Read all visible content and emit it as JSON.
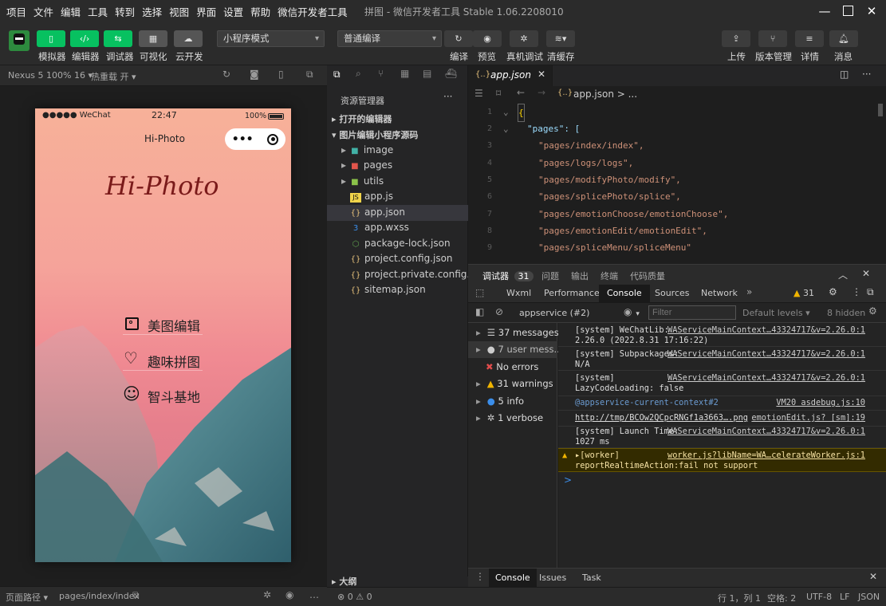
{
  "window": {
    "title": "拼图 - 微信开发者工具 Stable 1.06.2208010",
    "menus": [
      "项目",
      "文件",
      "编辑",
      "工具",
      "转到",
      "选择",
      "视图",
      "界面",
      "设置",
      "帮助",
      "微信开发者工具"
    ]
  },
  "toolbar": {
    "left_buttons": [
      "模拟器",
      "编辑器",
      "调试器",
      "可视化",
      "云开发"
    ],
    "mode_select": "小程序模式",
    "compile_select": "普通编译",
    "mid_buttons": [
      "编译",
      "预览",
      "真机调试",
      "清缓存"
    ],
    "right_buttons": [
      "上传",
      "版本管理",
      "详情",
      "消息"
    ]
  },
  "simulator": {
    "device": "Nexus 5 100% 16",
    "hot_reload": "热重载 开",
    "phone": {
      "carrier": "●●●●● WeChat",
      "time": "22:47",
      "battery": "100%",
      "nav_title": "Hi-Photo",
      "logo_text": "Hi-Photo",
      "menu_items": [
        {
          "label": "美图编辑",
          "icon": "image-icon"
        },
        {
          "label": "趣味拼图",
          "icon": "heart-icon"
        },
        {
          "label": "智斗基地",
          "icon": "smile-icon"
        }
      ]
    },
    "status": {
      "path_label": "页面路径",
      "path": "pages/index/index"
    }
  },
  "explorer": {
    "title": "资源管理器",
    "open_editors": "打开的编辑器",
    "project": "图片编辑小程序源码",
    "outline": "大纲",
    "tree": [
      {
        "name": "image",
        "type": "folder"
      },
      {
        "name": "pages",
        "type": "folder"
      },
      {
        "name": "utils",
        "type": "folder"
      },
      {
        "name": "app.js",
        "type": "js"
      },
      {
        "name": "app.json",
        "type": "json",
        "selected": true
      },
      {
        "name": "app.wxss",
        "type": "wxss"
      },
      {
        "name": "package-lock.json",
        "type": "lock"
      },
      {
        "name": "project.config.json",
        "type": "json"
      },
      {
        "name": "project.private.config.js...",
        "type": "json"
      },
      {
        "name": "sitemap.json",
        "type": "json"
      }
    ]
  },
  "editor": {
    "tab": "app.json",
    "breadcrumb": "app.json > ...",
    "lines": [
      {
        "n": "1",
        "text": "{"
      },
      {
        "n": "2",
        "text": "\"pages\": ["
      },
      {
        "n": "3",
        "text": "\"pages/index/index\","
      },
      {
        "n": "4",
        "text": "\"pages/logs/logs\","
      },
      {
        "n": "5",
        "text": "\"pages/modifyPhoto/modify\","
      },
      {
        "n": "6",
        "text": "\"pages/splicePhoto/splice\","
      },
      {
        "n": "7",
        "text": "\"pages/emotionChoose/emotionChoose\","
      },
      {
        "n": "8",
        "text": "\"pages/emotionEdit/emotionEdit\","
      },
      {
        "n": "9",
        "text": "\"pages/spliceMenu/spliceMenu\""
      }
    ]
  },
  "devtools": {
    "tabs": [
      {
        "label": "调试器",
        "badge": "31"
      },
      {
        "label": "问题"
      },
      {
        "label": "输出"
      },
      {
        "label": "终端"
      },
      {
        "label": "代码质量"
      }
    ],
    "nav": [
      "Wxml",
      "Performance",
      "Console",
      "Sources",
      "Network"
    ],
    "warn_count": "31",
    "context": "appservice (#2)",
    "filter_placeholder": "Filter",
    "levels": "Default levels",
    "hidden": "8 hidden",
    "sidebar": [
      {
        "label": "37 messages",
        "icon": "list-icon"
      },
      {
        "label": "7 user mess...",
        "icon": "user-icon"
      },
      {
        "label": "No errors",
        "icon": "error-icon"
      },
      {
        "label": "31 warnings",
        "icon": "warning-icon"
      },
      {
        "label": "5 info",
        "icon": "info-icon"
      },
      {
        "label": "1 verbose",
        "icon": "bug-icon"
      }
    ],
    "logs": [
      {
        "l1": "[system] WeChatLib:",
        "src": "WAServiceMainContext…43324717&v=2.26.0:1",
        "l2": "2.26.0 (2022.8.31 17:16:22)"
      },
      {
        "l1": "[system] Subpackages:",
        "src": "WAServiceMainContext…43324717&v=2.26.0:1",
        "l2": "N/A"
      },
      {
        "l1": "[system]",
        "src": "WAServiceMainContext…43324717&v=2.26.0:1",
        "l2": "LazyCodeLoading: false"
      },
      {
        "l1": "@appservice-current-context#2",
        "src": "VM20 asdebug.js:10",
        "l2": ""
      },
      {
        "l1": "http://tmp/BCOw2QCpcRNGf1a3663….png",
        "src": "emotionEdit.js? [sm]:19",
        "l2": ""
      },
      {
        "l1": "[system] Launch Time:",
        "src": "WAServiceMainContext…43324717&v=2.26.0:1",
        "l2": "1027 ms"
      },
      {
        "l1": "▸[worker]",
        "src": "worker.js?libName=WA…celerateWorker.js:1",
        "l2": "reportRealtimeAction:fail not support"
      }
    ],
    "prompt": ">",
    "bottom_tabs": [
      "Console",
      "Issues",
      "Task"
    ]
  },
  "statusbar": {
    "problems": "⊗ 0 ⚠ 0",
    "position": "行 1，列 1",
    "indent": "空格: 2",
    "encoding": "UTF-8",
    "eol": "LF",
    "lang": "JSON"
  },
  "colors": {
    "accent": "#07c160",
    "string": "#ce9178",
    "key": "#9cdcfe",
    "warning_bg": "#332b00"
  }
}
